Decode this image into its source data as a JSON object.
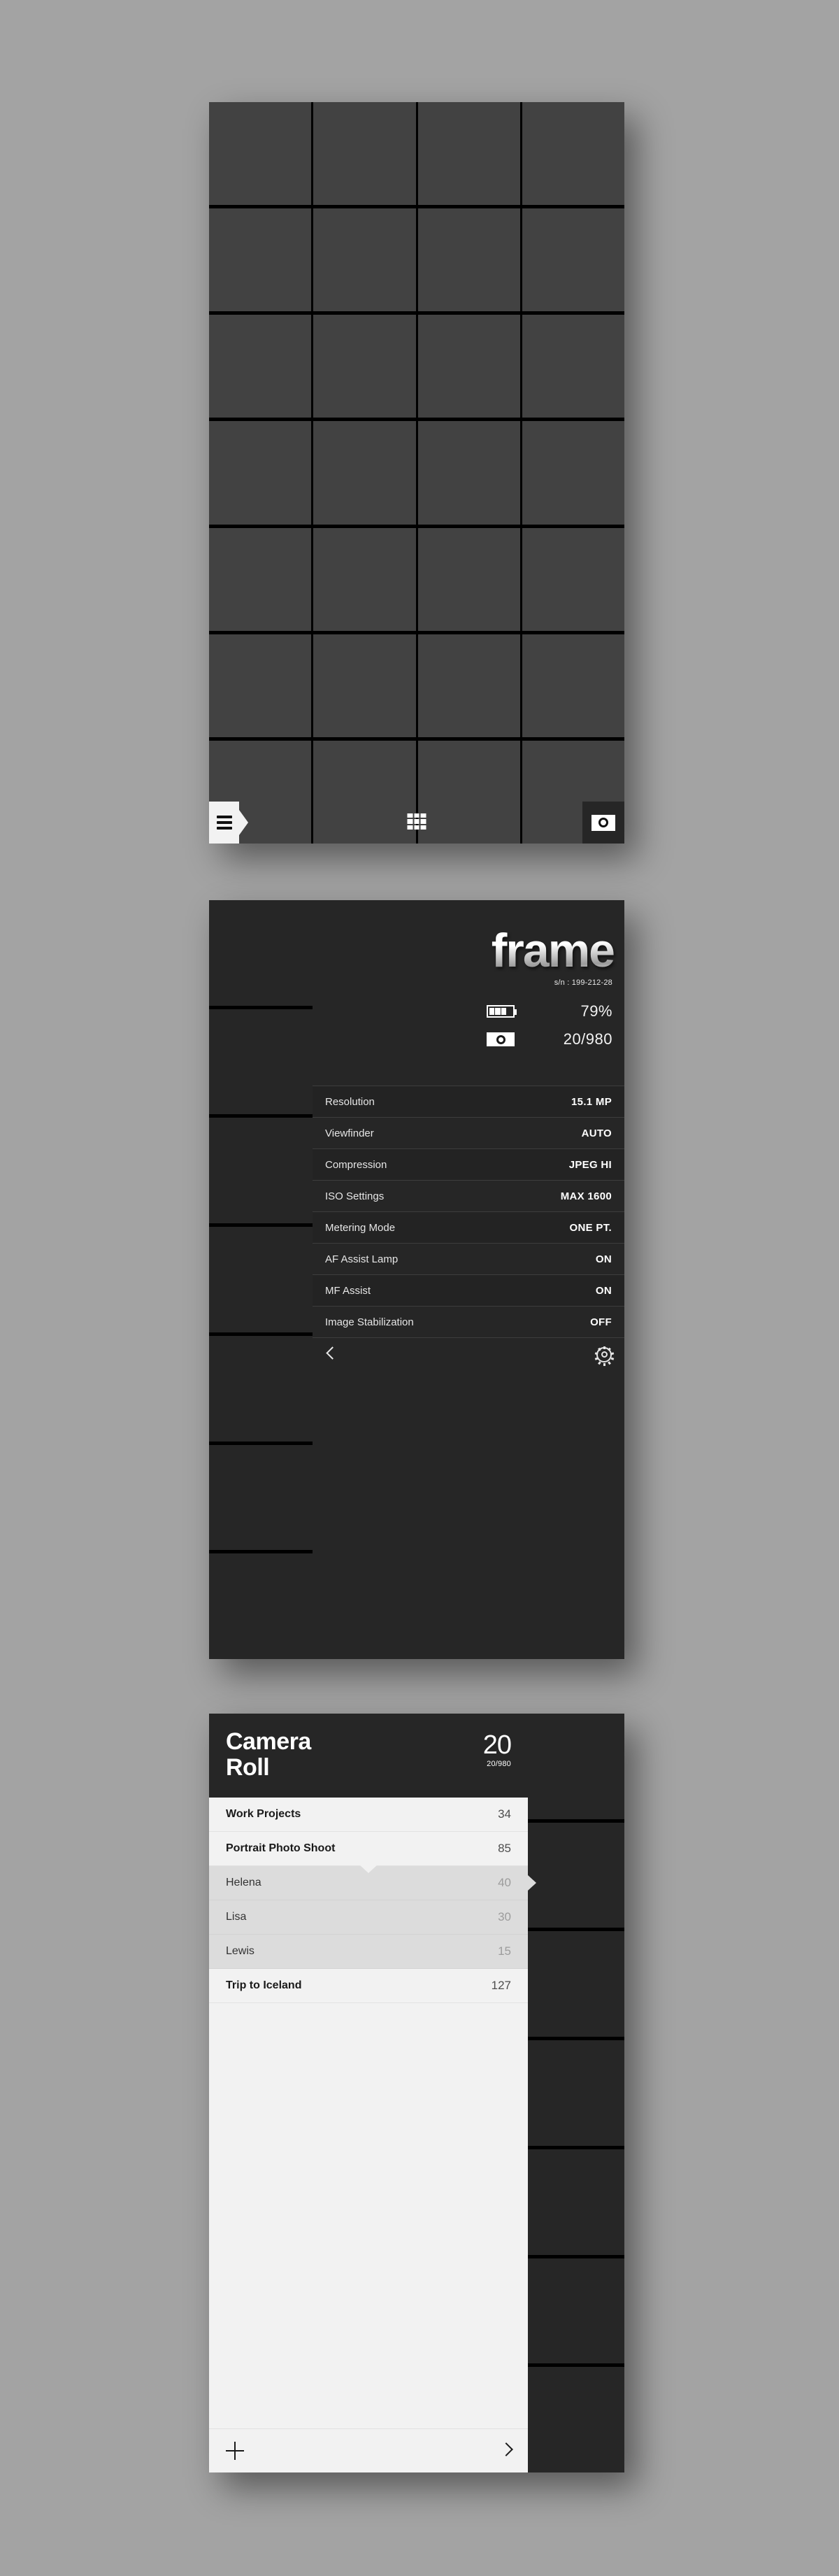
{
  "app": {
    "brand": "frame",
    "serial_label": "s/n : 199-212-28"
  },
  "viewfinder": {
    "grid_rows": 7,
    "grid_cols": 4,
    "toolbar": {
      "menu_icon": "hamburger-menu-icon",
      "grid_icon": "grid-view-icon",
      "shutter_icon": "camera-shutter-icon"
    }
  },
  "settings_screen": {
    "battery_percent": "79%",
    "battery_level": 79,
    "shots_counter": "20/980",
    "rows": [
      {
        "label": "Resolution",
        "value": "15.1 MP"
      },
      {
        "label": "Viewfinder",
        "value": "AUTO"
      },
      {
        "label": "Compression",
        "value": "JPEG HI"
      },
      {
        "label": "ISO Settings",
        "value": "MAX 1600"
      },
      {
        "label": "Metering Mode",
        "value": "ONE PT."
      },
      {
        "label": "AF Assist Lamp",
        "value": "ON"
      },
      {
        "label": "MF Assist",
        "value": "ON"
      },
      {
        "label": "Image Stabilization",
        "value": "OFF"
      }
    ],
    "footer": {
      "back_icon": "chevron-left-icon",
      "settings_icon": "gear-icon"
    }
  },
  "camera_roll": {
    "title_line1": "Camera",
    "title_line2": "Roll",
    "count_big": "20",
    "count_small": "20/980",
    "albums": [
      {
        "name": "Work Projects",
        "count": "34",
        "child": false,
        "selected": false
      },
      {
        "name": "Portrait Photo Shoot",
        "count": "85",
        "child": false,
        "selected": false
      },
      {
        "name": "Helena",
        "count": "40",
        "child": true,
        "selected": true
      },
      {
        "name": "Lisa",
        "count": "30",
        "child": true,
        "selected": false
      },
      {
        "name": "Lewis",
        "count": "15",
        "child": true,
        "selected": false
      },
      {
        "name": "Trip to Iceland",
        "count": "127",
        "child": false,
        "selected": false
      }
    ],
    "footer": {
      "add_icon": "plus-icon",
      "forward_icon": "chevron-right-icon"
    }
  },
  "colors": {
    "page_background": "#a3a3a3",
    "viewfinder_cell": "#424242",
    "panel_dark": "#262626",
    "drawer_light": "#f2f2f2",
    "drawer_child": "#dcdcdc"
  }
}
